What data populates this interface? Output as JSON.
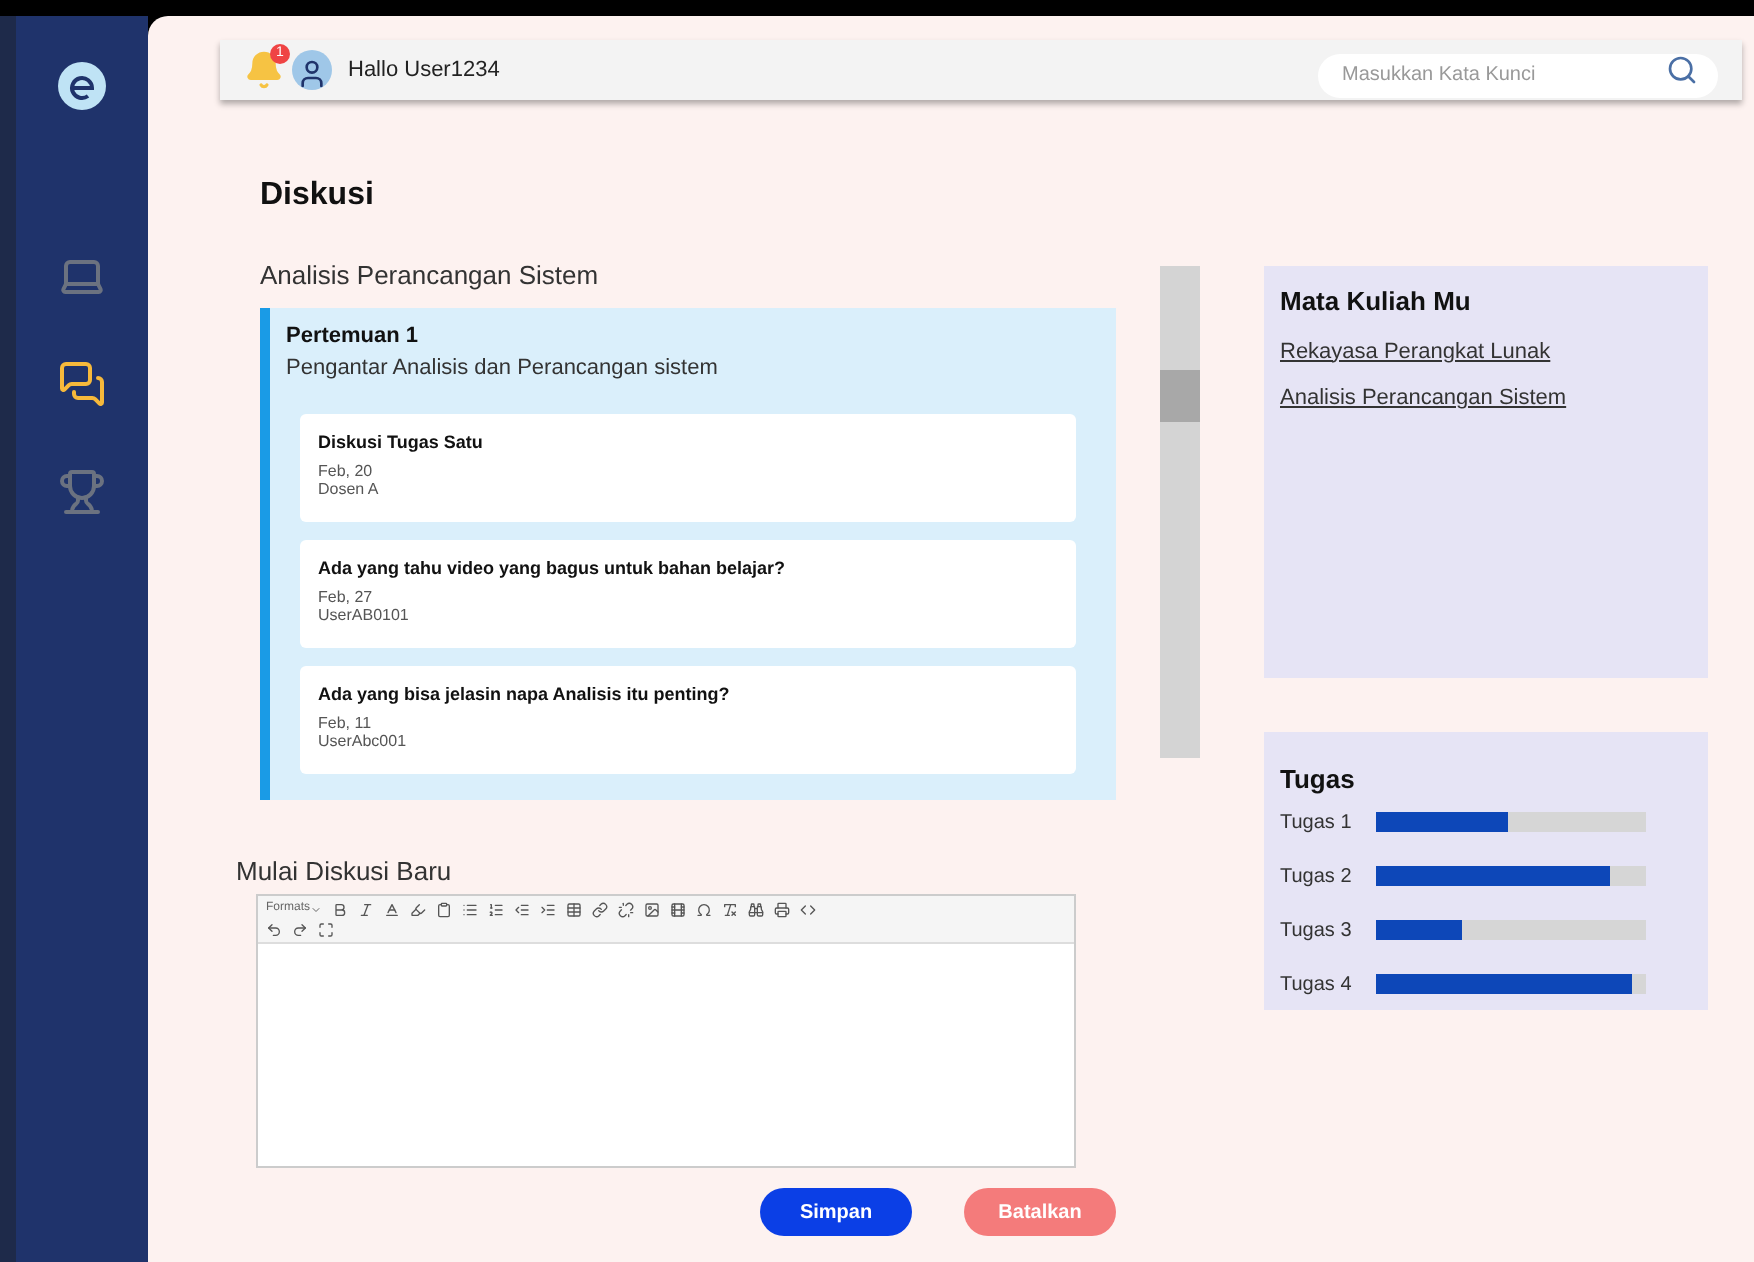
{
  "sidebar": {
    "items": [
      {
        "kind": "laptop",
        "selected": false
      },
      {
        "kind": "chat",
        "selected": true
      },
      {
        "kind": "trophy",
        "selected": false
      }
    ]
  },
  "header": {
    "notification_count": "1",
    "greeting": "Hallo User1234",
    "search": {
      "placeholder": "Masukkan Kata Kunci"
    }
  },
  "page_title": "Diskusi",
  "course_title": "Analisis Perancangan Sistem",
  "meeting": {
    "title": "Pertemuan 1",
    "subtitle": "Pengantar Analisis dan Perancangan sistem",
    "threads": [
      {
        "title": "Diskusi Tugas Satu",
        "date": "Feb, 20",
        "author": "Dosen A"
      },
      {
        "title": "Ada yang tahu video yang bagus untuk bahan belajar?",
        "date": "Feb, 27",
        "author": "UserAB0101"
      },
      {
        "title": "Ada yang bisa jelasin napa Analisis itu penting?",
        "date": "Feb, 11",
        "author": "UserAbc001"
      }
    ]
  },
  "new_discussion": {
    "title": "Mulai Diskusi Baru",
    "formats_label": "Formats",
    "buttons": [
      {
        "label": "Simpan",
        "kind": "primary"
      },
      {
        "label": "Batalkan",
        "kind": "danger"
      }
    ]
  },
  "courses": {
    "title": "Mata Kuliah Mu",
    "items": [
      "Rekayasa Perangkat Lunak",
      "Analisis Perancangan Sistem"
    ]
  },
  "tasks": {
    "title": "Tugas",
    "items": [
      {
        "label": "Tugas 1",
        "level": 0.49
      },
      {
        "label": "Tugas 2",
        "level": 0.87
      },
      {
        "label": "Tugas 3",
        "level": 0.32
      },
      {
        "label": "Tugas 4",
        "level": 0.95
      }
    ]
  }
}
